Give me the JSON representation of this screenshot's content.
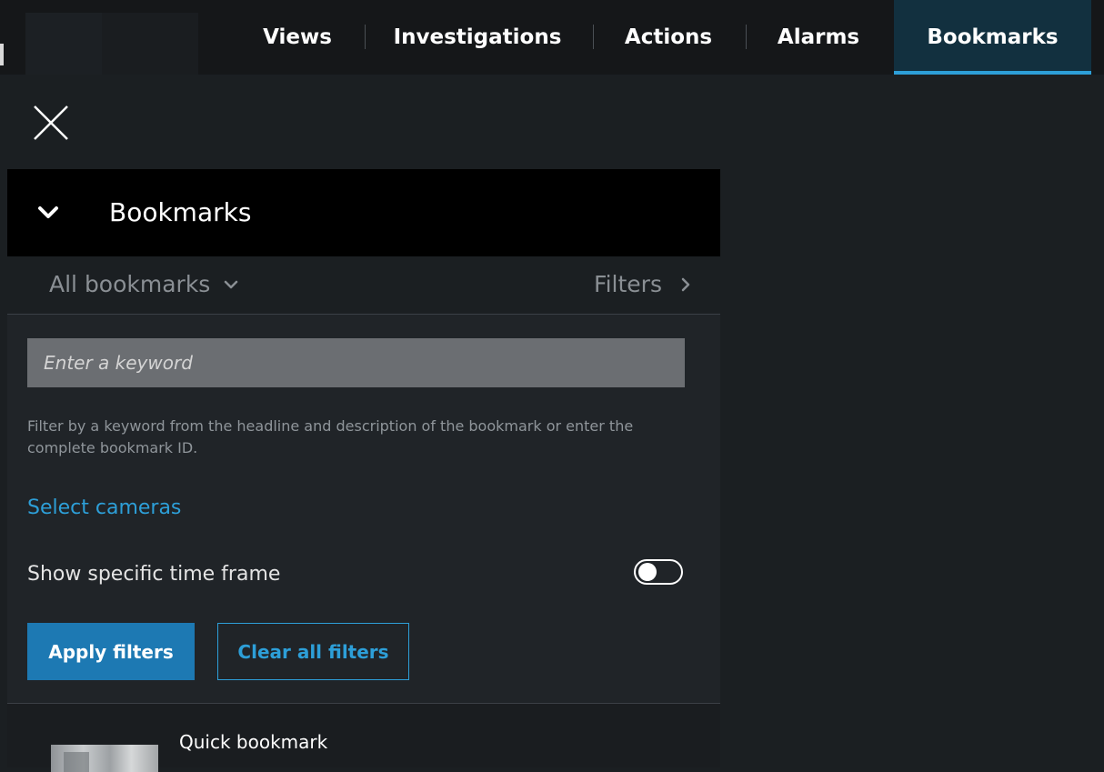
{
  "nav": {
    "tabs": [
      {
        "label": "Views"
      },
      {
        "label": "Investigations"
      },
      {
        "label": "Actions"
      },
      {
        "label": "Alarms"
      },
      {
        "label": "Bookmarks",
        "active": true
      }
    ]
  },
  "panel": {
    "title": "Bookmarks",
    "scope_dropdown": "All bookmarks",
    "filters_link": "Filters",
    "keyword_placeholder": "Enter a keyword",
    "help_text": "Filter by a keyword from the headline and description of the bookmark or enter the complete bookmark ID.",
    "select_cameras_link": "Select cameras",
    "time_frame_label": "Show specific time frame",
    "time_frame_enabled": false,
    "apply_button": "Apply filters",
    "clear_button": "Clear all filters",
    "results": [
      {
        "title": "Quick bookmark"
      }
    ]
  },
  "colors": {
    "accent": "#2d9fd8",
    "primary_button": "#1d79b3",
    "background": "#1b1f22",
    "panel": "#202428",
    "header": "#000000"
  },
  "icons": {
    "close": "close-icon",
    "collapse": "chevron-down-icon",
    "dropdown": "chevron-down-icon",
    "filters": "chevron-right-icon"
  }
}
